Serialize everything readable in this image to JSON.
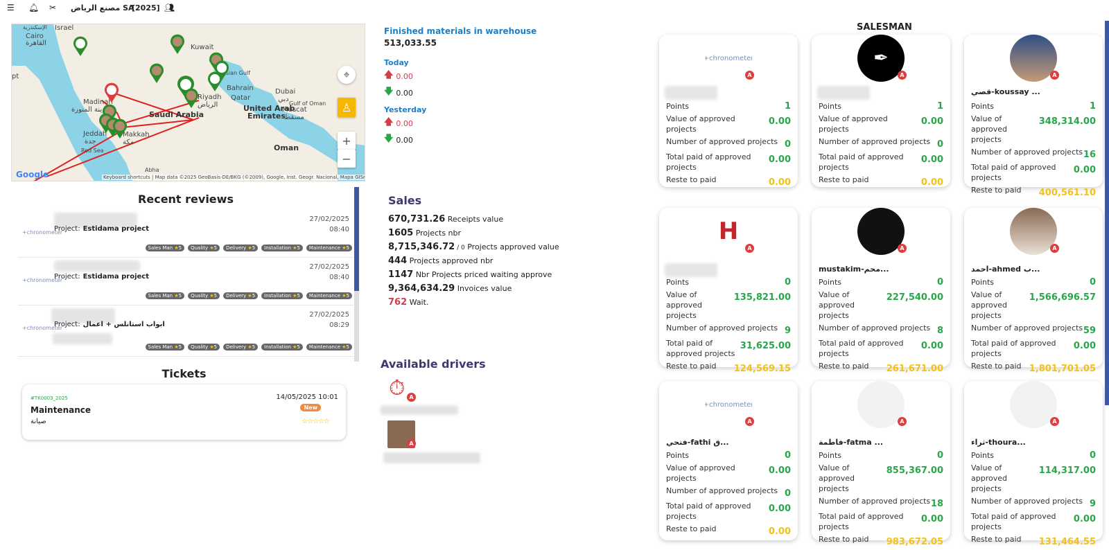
{
  "topbar": {
    "menu_icon": "menu-icon",
    "bell_icon": "bell-icon",
    "tools_icon": "tools-icon",
    "company": "مصنع الرياض SA",
    "year": "[2025]",
    "users_icon": "users-icon"
  },
  "map": {
    "labels": [
      "Cairo",
      "القاهرة",
      "Israel",
      "Kuwait",
      "Madinah",
      "المدينة المنورة",
      "Saudi Arabia",
      "Riyadh",
      "الرياض",
      "Bahrain",
      "Qatar",
      "Dubai",
      "دبي",
      "United Arab",
      "Emirates",
      "Muscat",
      "مسقط",
      "Gulf of Oman",
      "Oman",
      "Jeddah",
      "جدة",
      "Makkah",
      "مكة",
      "Red Sea",
      "Persian Gulf",
      "Abha",
      "pt",
      "الإسكندرية"
    ],
    "attribution": "Keyboard shortcuts | Map data ©2025 GeoBasis-DE/BKG (©2009), Google, Inst. Geogr. Nacional, Mapa GISrael | Terms",
    "google": "Google"
  },
  "warehouse": {
    "title": "Finished materials in warehouse",
    "value": "513,033.55",
    "today": "Today",
    "today_up": "0.00",
    "today_down": "0.00",
    "yesterday": "Yesterday",
    "yest_up": "0.00",
    "yest_down": "0.00"
  },
  "reviews": {
    "title": "Recent reviews",
    "items": [
      {
        "project_label": "Project:",
        "project": "Estidama project",
        "date": "27/02/2025",
        "time": "08:40"
      },
      {
        "project_label": "Project:",
        "project": "Estidama project",
        "date": "27/02/2025",
        "time": "08:40"
      },
      {
        "project_label": "Project:",
        "project": "ابواب استانلس + اعمال",
        "date": "27/02/2025",
        "time": "08:29"
      }
    ],
    "tags": [
      "Sales Man",
      "Quality",
      "Delivery",
      "Installation",
      "Maintenance"
    ],
    "score": "5"
  },
  "tickets": {
    "title": "Tickets",
    "code": "#TK0003_2025",
    "datetime": "14/05/2025 10:01",
    "name": "Maintenance",
    "arabic": "صيانة",
    "status": "New",
    "stars": "☆☆☆☆☆"
  },
  "sales": {
    "title": "Sales",
    "rows": [
      {
        "value": "670,731.26",
        "label": "Receipts value"
      },
      {
        "value": "1605",
        "label": "Projects nbr"
      },
      {
        "value": "8,715,346.72",
        "suffix": " / 0",
        "label": "Projects approved value"
      },
      {
        "value": "444",
        "label": "Projects approved nbr"
      },
      {
        "value": "1147",
        "label": "Nbr Projects priced waiting approve"
      },
      {
        "value": "9,364,634.29",
        "label": "Invoices value"
      },
      {
        "value": "762",
        "label": "Wait."
      }
    ]
  },
  "drivers": {
    "title": "Available drivers",
    "badge": "A"
  },
  "salesman": {
    "title": "SALESMAN",
    "labels": {
      "points": "Points",
      "value": "Value of approved projects",
      "number": "Number of approved projects",
      "paid": "Total paid of approved projects",
      "reste": "Reste to paid"
    },
    "badge": "A",
    "cards": [
      {
        "name": "",
        "points": "1",
        "value": "0.00",
        "number": "0",
        "paid": "0.00",
        "reste": "0.00",
        "avatar": "chronometer"
      },
      {
        "name": "",
        "points": "1",
        "value": "0.00",
        "number": "0",
        "paid": "0.00",
        "reste": "0.00",
        "avatar": "calligraphy"
      },
      {
        "name": "قصي-koussay ...",
        "points": "1",
        "value": "348,314.00",
        "number": "16",
        "paid": "0.00",
        "reste": "400,561.10",
        "avatar": "photo"
      },
      {
        "name": "",
        "points": "0",
        "value": "135,821.00",
        "number": "9",
        "paid": "31,625.00",
        "reste": "124,569.15",
        "avatar": "hosino"
      },
      {
        "name": "mustakim-محم...",
        "points": "0",
        "value": "227,540.00",
        "number": "8",
        "paid": "0.00",
        "reste": "261,671.00",
        "avatar": "dark"
      },
      {
        "name": "احمد-ahmed ب...",
        "points": "0",
        "value": "1,566,696.57",
        "number": "59",
        "paid": "0.00",
        "reste": "1,801,701.05",
        "avatar": "photo2"
      },
      {
        "name": "فتحي-fathi ق...",
        "points": "0",
        "value": "0.00",
        "number": "0",
        "paid": "0.00",
        "reste": "0.00",
        "avatar": "chronometer"
      },
      {
        "name": "فاطمة-fatma ...",
        "points": "0",
        "value": "855,367.00",
        "number": "18",
        "paid": "0.00",
        "reste": "983,672.05",
        "avatar": "blank"
      },
      {
        "name": "ثراء-thoura...",
        "points": "0",
        "value": "114,317.00",
        "number": "9",
        "paid": "0.00",
        "reste": "131,464.55",
        "avatar": "blank"
      }
    ]
  },
  "chrono_logo": {
    "main": "+chrono",
    "rest": "meter"
  }
}
